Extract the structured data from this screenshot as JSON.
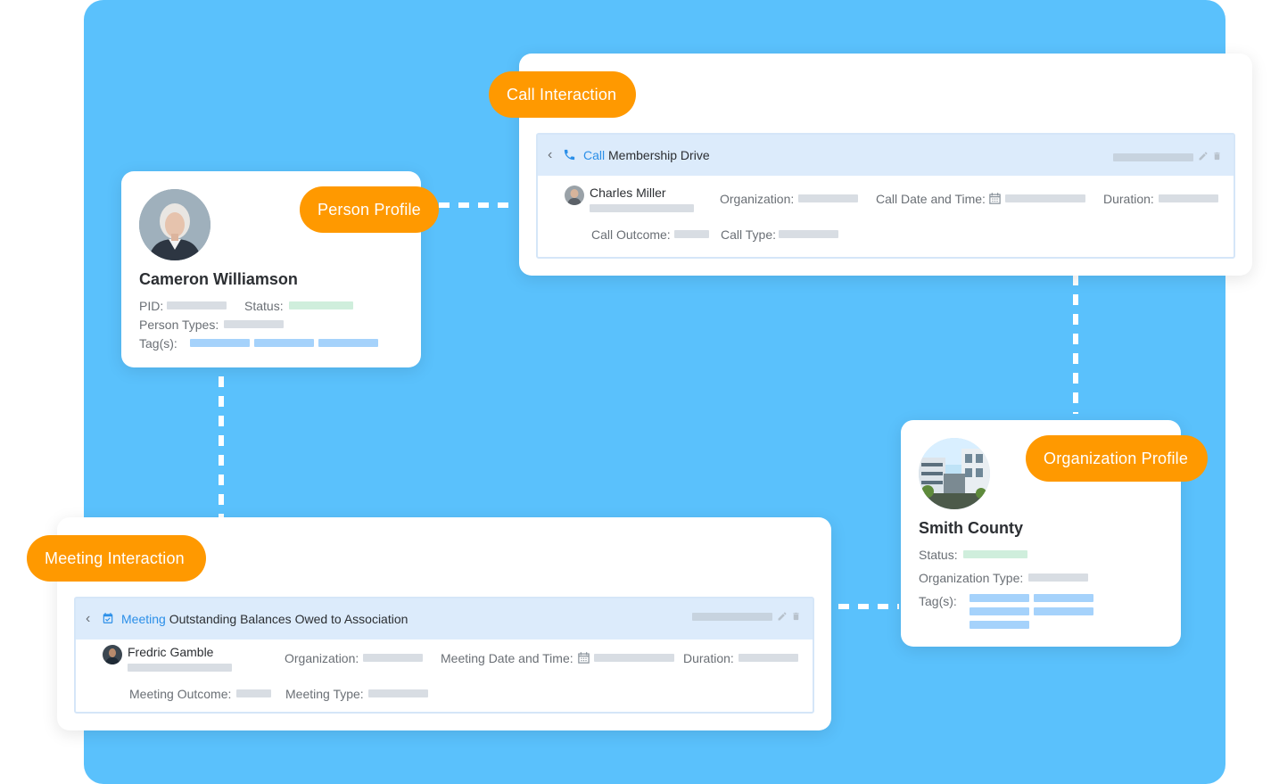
{
  "person_profile": {
    "badge": "Person Profile",
    "name": "Cameron Williamson",
    "pid_label": "PID:",
    "status_label": "Status:",
    "person_types_label": "Person Types:",
    "tags_label": "Tag(s):"
  },
  "call_interaction": {
    "badge": "Call Interaction",
    "kind": "Call",
    "title": "Membership Drive",
    "contact_name": "Charles Miller",
    "organization_label": "Organization:",
    "date_label": "Call Date and Time:",
    "duration_label": "Duration:",
    "outcome_label": "Call Outcome:",
    "type_label": "Call Type:"
  },
  "organization_profile": {
    "badge": "Organization Profile",
    "name": "Smith County",
    "status_label": "Status:",
    "org_type_label": "Organization Type:",
    "tags_label": "Tag(s):"
  },
  "meeting_interaction": {
    "badge": "Meeting Interaction",
    "kind": "Meeting",
    "title": "Outstanding Balances Owed to Association",
    "contact_name": "Fredric Gamble",
    "organization_label": "Organization:",
    "date_label": "Meeting Date and Time:",
    "duration_label": "Duration:",
    "outcome_label": "Meeting Outcome:",
    "type_label": "Meeting Type:"
  },
  "colors": {
    "background_panel": "#5ac1fc",
    "badge": "#ff9900",
    "link_blue": "#2b8fe8",
    "header_blue": "#dcebfb"
  }
}
